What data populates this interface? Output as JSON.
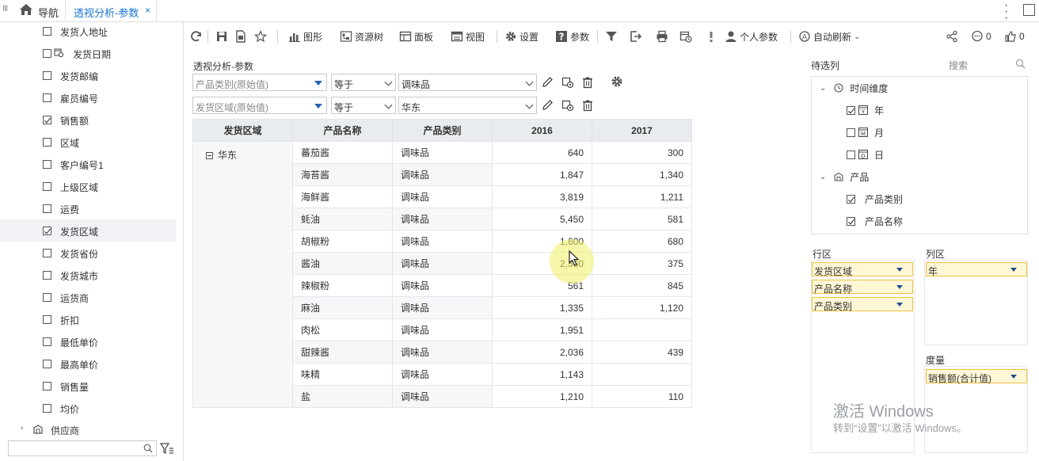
{
  "topbar": {
    "menu_glyph": "III",
    "nav_label": "导航",
    "tab_label": "透视分析-参数",
    "tab_close": "×"
  },
  "left_fields": [
    {
      "label": "发货人地址",
      "checked": false
    },
    {
      "label": "发货日期",
      "checked": false,
      "calendar": true
    },
    {
      "label": "发货邮编",
      "checked": false
    },
    {
      "label": "雇员编号",
      "checked": false
    },
    {
      "label": "销售额",
      "checked": true
    },
    {
      "label": "区域",
      "checked": false
    },
    {
      "label": "客户编号1",
      "checked": false
    },
    {
      "label": "上级区域",
      "checked": false
    },
    {
      "label": "运费",
      "checked": false
    },
    {
      "label": "发货区域",
      "checked": true,
      "selected": true
    },
    {
      "label": "发货省份",
      "checked": false
    },
    {
      "label": "发货城市",
      "checked": false
    },
    {
      "label": "运货商",
      "checked": false
    },
    {
      "label": "折扣",
      "checked": false
    },
    {
      "label": "最低单价",
      "checked": false
    },
    {
      "label": "最高单价",
      "checked": false
    },
    {
      "label": "销售量",
      "checked": false
    },
    {
      "label": "均价",
      "checked": false
    }
  ],
  "left_supplier": "供应商",
  "toolbar": {
    "graph": "图形",
    "resource_tree": "资源树",
    "panel": "面板",
    "view": "视图",
    "settings": "设置",
    "params": "参数",
    "personal_params": "个人参数",
    "auto_refresh": "自动刷新",
    "comments": "0",
    "likes": "0"
  },
  "report": {
    "title": "透视分析-参数",
    "filters": [
      {
        "field": "产品类别(原始值)",
        "operator": "等于",
        "value": "调味品"
      },
      {
        "field": "发货区域(原始值)",
        "operator": "等于",
        "value": "华东"
      }
    ]
  },
  "table": {
    "headers": [
      "发货区域",
      "产品名称",
      "产品类别",
      "2016",
      "2017"
    ],
    "region": "华东",
    "rows": [
      {
        "name": "蕃茄酱",
        "category": "调味品",
        "y2016": "640",
        "y2017": "300"
      },
      {
        "name": "海苔酱",
        "category": "调味品",
        "y2016": "1,847",
        "y2017": "1,340"
      },
      {
        "name": "海鲜酱",
        "category": "调味品",
        "y2016": "3,819",
        "y2017": "1,211"
      },
      {
        "name": "蚝油",
        "category": "调味品",
        "y2016": "5,450",
        "y2017": "581"
      },
      {
        "name": "胡椒粉",
        "category": "调味品",
        "y2016": "1,600",
        "y2017": "680"
      },
      {
        "name": "酱油",
        "category": "调味品",
        "y2016": "2,360",
        "y2017": "375"
      },
      {
        "name": "辣椒粉",
        "category": "调味品",
        "y2016": "561",
        "y2017": "845"
      },
      {
        "name": "麻油",
        "category": "调味品",
        "y2016": "1,335",
        "y2017": "1,120"
      },
      {
        "name": "肉松",
        "category": "调味品",
        "y2016": "1,951",
        "y2017": ""
      },
      {
        "name": "甜辣酱",
        "category": "调味品",
        "y2016": "2,036",
        "y2017": "439"
      },
      {
        "name": "味精",
        "category": "调味品",
        "y2016": "1,143",
        "y2017": ""
      },
      {
        "name": "盐",
        "category": "调味品",
        "y2016": "1,210",
        "y2017": "110"
      }
    ]
  },
  "right_panel": {
    "title": "待选列",
    "search_label": "搜索",
    "time_dimension": "时间维度",
    "time_items": [
      {
        "label": "年",
        "checked": true
      },
      {
        "label": "月",
        "checked": false
      },
      {
        "label": "日",
        "checked": false
      }
    ],
    "product": "产品",
    "product_items": [
      {
        "label": "产品类别",
        "checked": true
      },
      {
        "label": "产品名称",
        "checked": true
      }
    ],
    "row_zone_label": "行区",
    "row_chips": [
      "发货区域",
      "产品名称",
      "产品类别"
    ],
    "col_zone_label": "列区",
    "col_chips": [
      "年"
    ],
    "measure_label": "度量",
    "measure_chips": [
      "销售额(合计值)"
    ]
  },
  "watermark": {
    "line1": "激活 Windows",
    "line2": "转到“设置”以激活 Windows。"
  },
  "colors": {
    "accent": "#1976d2",
    "chip_bg": "#fff7d6",
    "chip_border": "#f0c040",
    "header_bg": "#e9ecef"
  }
}
